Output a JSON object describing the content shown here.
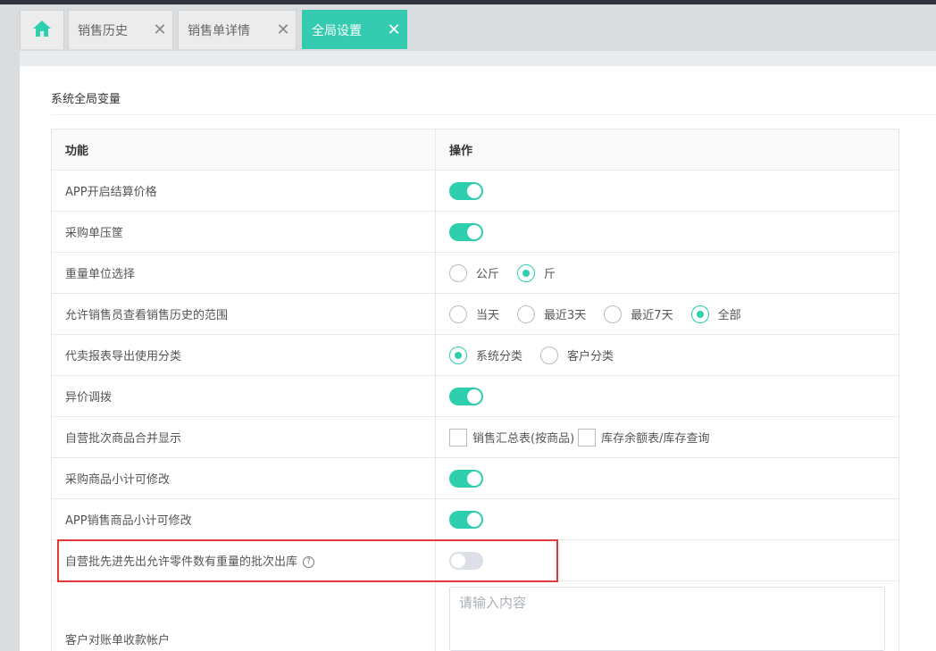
{
  "tabs": [
    {
      "label": "",
      "icon": "home-icon"
    },
    {
      "label": "销售历史",
      "close": "✕"
    },
    {
      "label": "销售单详情",
      "close": "✕"
    },
    {
      "label": "全局设置",
      "close": "✕",
      "active": true
    }
  ],
  "section_title": "系统全局变量",
  "table": {
    "header_feature": "功能",
    "header_action": "操作",
    "rows": {
      "app_settlement_price": {
        "label": "APP开启结算价格",
        "switch": "on"
      },
      "purchase_basket": {
        "label": "采购单压筐",
        "switch": "on"
      },
      "weight_unit": {
        "label": "重量单位选择",
        "options": [
          "公斤",
          "斤"
        ],
        "selected": "斤"
      },
      "sales_history_range": {
        "label": "允许销售员查看销售历史的范围",
        "options": [
          "当天",
          "最近3天",
          "最近7天",
          "全部"
        ],
        "selected": "全部"
      },
      "consign_report_category": {
        "label": "代卖报表导出使用分类",
        "options": [
          "系统分类",
          "客户分类"
        ],
        "selected": "系统分类"
      },
      "price_transfer": {
        "label": "异价调拨",
        "switch": "on"
      },
      "self_batch_merge": {
        "label": "自营批次商品合并显示",
        "checks": [
          "销售汇总表(按商品)",
          "库存余额表/库存查询"
        ]
      },
      "purchase_subtotal_edit": {
        "label": "采购商品小计可修改",
        "switch": "on"
      },
      "app_sales_subtotal_edit": {
        "label": "APP销售商品小计可修改",
        "switch": "on"
      },
      "fifo_weight_batch": {
        "label": "自营批先进先出允许零件数有重量的批次出库",
        "help": "?",
        "switch": "off"
      },
      "customer_account": {
        "label": "客户对账单收款帐户",
        "placeholder": "请输入内容"
      }
    }
  },
  "colors": {
    "accent": "#2ecfaf",
    "highlight": "#e53935"
  }
}
